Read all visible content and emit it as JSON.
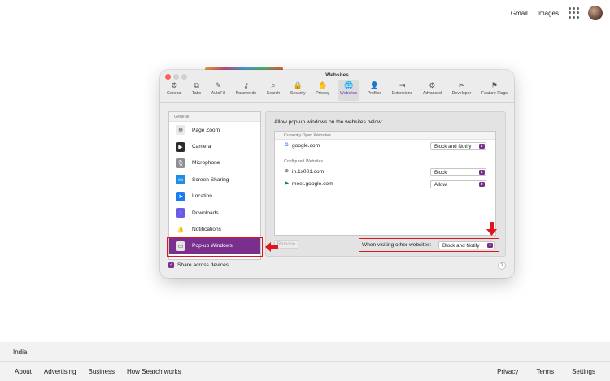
{
  "google": {
    "top_links": [
      "Gmail",
      "Images"
    ],
    "footer": {
      "country": "India",
      "left_links": [
        "About",
        "Advertising",
        "Business",
        "How Search works"
      ],
      "right_links": [
        "Privacy",
        "Terms",
        "Settings"
      ]
    }
  },
  "window": {
    "title": "Websites",
    "toolbar": [
      {
        "label": "General",
        "icon": "gear-icon",
        "glyph": "⚙"
      },
      {
        "label": "Tabs",
        "icon": "tabs-icon",
        "glyph": "⧉"
      },
      {
        "label": "AutoFill",
        "icon": "autofill-icon",
        "glyph": "✎"
      },
      {
        "label": "Passwords",
        "icon": "key-icon",
        "glyph": "⚷"
      },
      {
        "label": "Search",
        "icon": "search-icon",
        "glyph": "⌕"
      },
      {
        "label": "Security",
        "icon": "lock-icon",
        "glyph": "🔒"
      },
      {
        "label": "Privacy",
        "icon": "hand-icon",
        "glyph": "✋"
      },
      {
        "label": "Websites",
        "icon": "globe-icon",
        "glyph": "🌐",
        "active": true
      },
      {
        "label": "Profiles",
        "icon": "person-icon",
        "glyph": "👤"
      },
      {
        "label": "Extensions",
        "icon": "extensions-icon",
        "glyph": "⇥"
      },
      {
        "label": "Advanced",
        "icon": "gears-icon",
        "glyph": "⚙"
      },
      {
        "label": "Developer",
        "icon": "tools-icon",
        "glyph": "✂"
      },
      {
        "label": "Feature Flags",
        "icon": "flags-icon",
        "glyph": "⚑"
      }
    ],
    "sidebar": {
      "header": "General",
      "items": [
        {
          "label": "Page Zoom",
          "icon": "zoom-icon",
          "glyph": "⊕",
          "color": "#e9e9e9",
          "fg": "#444"
        },
        {
          "label": "Camera",
          "icon": "camera-icon",
          "glyph": "▶",
          "color": "#2b2b2b",
          "fg": "#fff"
        },
        {
          "label": "Microphone",
          "icon": "microphone-icon",
          "glyph": "🎙",
          "color": "#8e8e93",
          "fg": "#fff"
        },
        {
          "label": "Screen Sharing",
          "icon": "screen-sharing-icon",
          "glyph": "▭",
          "color": "#1f8fe5",
          "fg": "#fff"
        },
        {
          "label": "Location",
          "icon": "location-icon",
          "glyph": "➤",
          "color": "#1a7cf0",
          "fg": "#fff"
        },
        {
          "label": "Downloads",
          "icon": "downloads-icon",
          "glyph": "↓",
          "color": "#6b5ce7",
          "fg": "#fff"
        },
        {
          "label": "Notifications",
          "icon": "bell-icon",
          "glyph": "🔔",
          "color": "#ffffff",
          "fg": "#e53935"
        },
        {
          "label": "Pop-up Windows",
          "icon": "popup-icon",
          "glyph": "▭",
          "color": "#e5e5e5",
          "fg": "#555",
          "selected": true
        }
      ],
      "share_label": "Share across devices",
      "share_checked": true
    },
    "pane": {
      "title": "Allow pop-up windows on the websites below:",
      "open_header": "Currently Open Websites",
      "open_sites": [
        {
          "name": "google.com",
          "setting": "Block and Notify",
          "icon": "google-icon",
          "glyph": "G",
          "color": "#4285f4"
        }
      ],
      "configured_header": "Configured Websites",
      "configured_sites": [
        {
          "name": "in.1x001.com",
          "setting": "Block",
          "icon": "globe-icon",
          "glyph": "⊕",
          "color": "#777"
        },
        {
          "name": "meet.google.com",
          "setting": "Allow",
          "icon": "meet-icon",
          "glyph": "▶",
          "color": "#00897b"
        }
      ],
      "remove_label": "Remove",
      "other_label": "When visiting other websites:",
      "other_value": "Block and Notify",
      "help": "?"
    },
    "colors": {
      "accent": "#7a2f8c",
      "highlight": "#e0151f"
    }
  }
}
